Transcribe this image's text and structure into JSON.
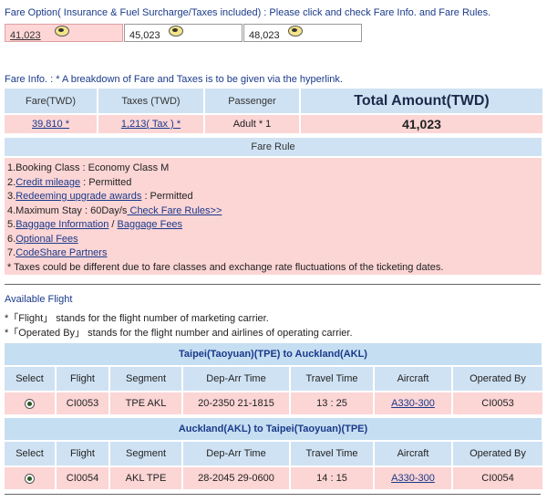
{
  "fare_option": {
    "header": "Fare Option( Insurance & Fuel Surcharge/Taxes included) : Please click and check Fare Info. and Fare Rules.",
    "options": [
      {
        "amount": "41,023"
      },
      {
        "amount": "45,023"
      },
      {
        "amount": "48,023"
      }
    ]
  },
  "fare_info": {
    "note": "Fare Info. : * A breakdown of Fare and Taxes is to be given via the hyperlink.",
    "headers": {
      "fare": "Fare(TWD)",
      "taxes": "Taxes (TWD)",
      "passenger": "Passenger",
      "total": "Total Amount(TWD)"
    },
    "row": {
      "fare": "39,810 *",
      "taxes": "1,213( Tax ) *",
      "passenger": "Adult * 1",
      "total": "41,023"
    }
  },
  "fare_rule": {
    "title": "Fare Rule",
    "l1": "1.Booking Class : Economy Class M",
    "l2_num": "2.",
    "l2_link": "Credit mileage",
    "l2_rest": " : Permitted",
    "l3_num": "3.",
    "l3_link": "Redeeming upgrade awards",
    "l3_rest": " : Permitted",
    "l4_text": "4.Maximum Stay : 60Day/s",
    "l4_link": " Check Fare Rules>>",
    "l5_num": "5.",
    "l5_link1": "Baggage Information",
    "l5_sep": " / ",
    "l5_link2": "Baggage Fees",
    "l6_num": "6.",
    "l6_link": "Optional Fees",
    "l7_num": "7.",
    "l7_link": "CodeShare Partners",
    "note": "* Taxes could be different due to fare classes and exchange rate fluctuations of the ticketing dates."
  },
  "available_flight": {
    "title": "Available Flight",
    "note1": "*「Flight」 stands for the flight number of marketing carrier.",
    "note2": "*「Operated By」 stands for the flight number and airlines of operating carrier.",
    "columns": [
      "Select",
      "Flight",
      "Segment",
      "Dep-Arr Time",
      "Travel Time",
      "Aircraft",
      "Operated By"
    ],
    "segments": [
      {
        "title": "Taipei(Taoyuan)(TPE) to Auckland(AKL)",
        "flight": "CI0053",
        "segment": "TPE AKL",
        "time": "20-2350 21-1815",
        "travel": "13 : 25",
        "aircraft": "A330-300",
        "operated": "CI0053"
      },
      {
        "title": "Auckland(AKL) to Taipei(Taoyuan)(TPE)",
        "flight": "CI0054",
        "segment": "AKL TPE",
        "time": "28-2045 29-0600",
        "travel": "14 : 15",
        "aircraft": "A330-300",
        "operated": "CI0054"
      }
    ]
  }
}
